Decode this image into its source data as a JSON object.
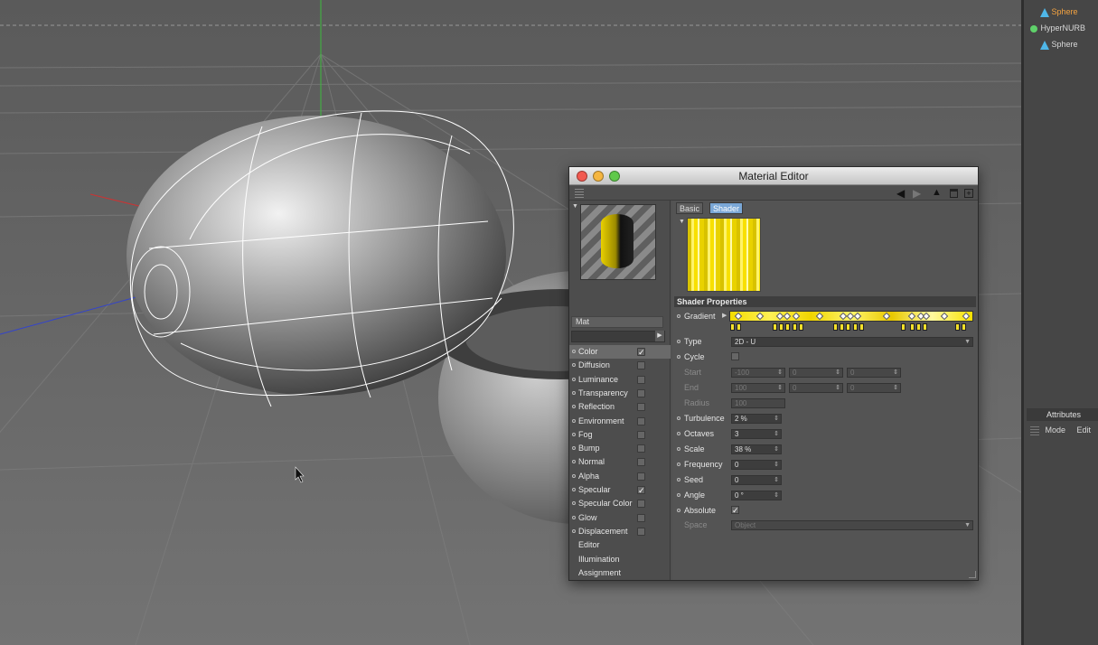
{
  "side_panel": {
    "objects": [
      {
        "label": "Sphere",
        "color": "#f4a340"
      },
      {
        "label": "HyperNURB",
        "color": "#e0e0e0"
      },
      {
        "label": "Sphere",
        "color": "#e0e0e0"
      }
    ],
    "attributes_title": "Attributes",
    "attributes_menu": [
      "Mode",
      "Edit"
    ]
  },
  "material_editor": {
    "title": "Material Editor",
    "material_name": "Mat",
    "channels": [
      {
        "label": "Color",
        "checked": true,
        "selected": true
      },
      {
        "label": "Diffusion",
        "checked": false
      },
      {
        "label": "Luminance",
        "checked": false
      },
      {
        "label": "Transparency",
        "checked": false
      },
      {
        "label": "Reflection",
        "checked": false
      },
      {
        "label": "Environment",
        "checked": false
      },
      {
        "label": "Fog",
        "checked": false
      },
      {
        "label": "Bump",
        "checked": false
      },
      {
        "label": "Normal",
        "checked": false
      },
      {
        "label": "Alpha",
        "checked": false
      },
      {
        "label": "Specular",
        "checked": true
      },
      {
        "label": "Specular Color",
        "checked": false
      },
      {
        "label": "Glow",
        "checked": false
      },
      {
        "label": "Displacement",
        "checked": false
      }
    ],
    "extra_items": [
      "Editor",
      "Illumination",
      "Assignment"
    ],
    "tabs": [
      "Basic",
      "Shader"
    ],
    "active_tab": "Shader",
    "section_title": "Shader Properties",
    "properties": {
      "gradient_label": "Gradient",
      "type_label": "Type",
      "type_value": "2D - U",
      "cycle_label": "Cycle",
      "start_label": "Start",
      "start_values": [
        "-100",
        "0",
        "0"
      ],
      "end_label": "End",
      "end_values": [
        "100",
        "0",
        "0"
      ],
      "radius_label": "Radius",
      "radius_value": "100",
      "turbulence_label": "Turbulence",
      "turbulence_value": "2 %",
      "octaves_label": "Octaves",
      "octaves_value": "3",
      "scale_label": "Scale",
      "scale_value": "38 %",
      "frequency_label": "Frequency",
      "frequency_value": "0",
      "seed_label": "Seed",
      "seed_value": "0",
      "angle_label": "Angle",
      "angle_value": "0 °",
      "absolute_label": "Absolute",
      "absolute_checked": true,
      "space_label": "Space",
      "space_value": "Object"
    },
    "accent_color": "#f4dc00"
  }
}
